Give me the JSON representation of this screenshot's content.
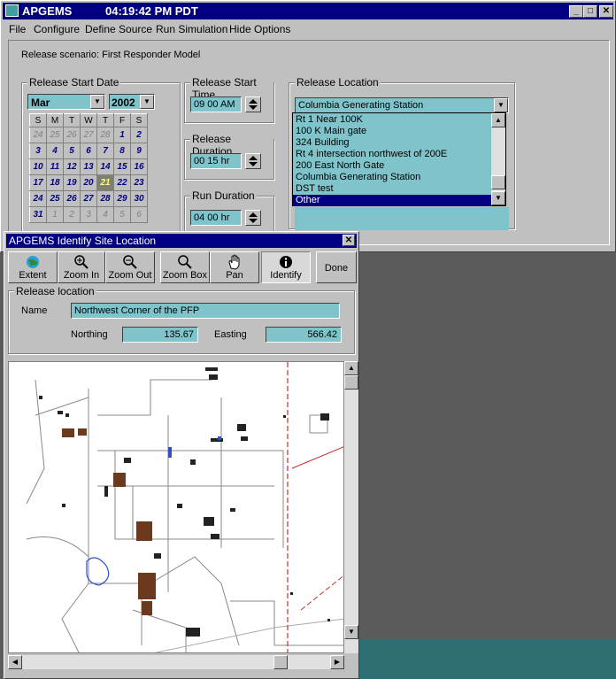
{
  "app": {
    "title": "APGEMS",
    "clock": "04:19:42 PM PDT"
  },
  "menu": [
    "File",
    "Configure",
    "Define Source",
    "Run Simulation",
    "Hide Options"
  ],
  "scenario": "Release scenario: First Responder Model",
  "start_date": {
    "label": "Release Start Date",
    "month": "Mar",
    "year": "2002",
    "weekdays": [
      "S",
      "M",
      "T",
      "W",
      "T",
      "F",
      "S"
    ],
    "weeks": [
      [
        "24",
        "25",
        "26",
        "27",
        "28",
        "1",
        "2"
      ],
      [
        "3",
        "4",
        "5",
        "6",
        "7",
        "8",
        "9"
      ],
      [
        "10",
        "11",
        "12",
        "13",
        "14",
        "15",
        "16"
      ],
      [
        "17",
        "18",
        "19",
        "20",
        "21",
        "22",
        "23"
      ],
      [
        "24",
        "25",
        "26",
        "27",
        "28",
        "29",
        "30"
      ],
      [
        "31",
        "1",
        "2",
        "3",
        "4",
        "5",
        "6"
      ]
    ],
    "selected_day": "21"
  },
  "start_time": {
    "label": "Release Start Time",
    "value": "09  00 AM"
  },
  "duration": {
    "label": "Release Duration",
    "value": "00  15 hr"
  },
  "run_duration": {
    "label": "Run Duration",
    "value": "04  00 hr"
  },
  "location": {
    "label": "Release Location",
    "selected": "Columbia Generating Station",
    "options": [
      "Rt 1 Near 100K",
      "100 K Main gate",
      "324 Building",
      "Rt 4 intersection northwest of 200E",
      "200 East North Gate",
      "Columbia Generating Station",
      "DST test",
      "Other"
    ],
    "highlighted": "Other"
  },
  "identify_window": {
    "title": "APGEMS Identify Site Location",
    "toolbar": [
      {
        "label": "Extent",
        "icon": "globe-icon"
      },
      {
        "label": "Zoom In",
        "icon": "zoom-in-icon"
      },
      {
        "label": "Zoom Out",
        "icon": "zoom-out-icon"
      },
      {
        "label": "Zoom Box",
        "icon": "zoom-box-icon"
      },
      {
        "label": "Pan",
        "icon": "hand-icon"
      },
      {
        "label": "Identify",
        "icon": "info-icon"
      }
    ],
    "done_label": "Done",
    "group_label": "Release location",
    "name_label": "Name",
    "name_value": "Northwest Corner of the PFP",
    "northing_label": "Northing",
    "northing_value": "135.67",
    "easting_label": "Easting",
    "easting_value": "566.42"
  },
  "colors": {
    "titlebar": "#000080",
    "field": "#7fc3cb",
    "face": "#c0c0c0",
    "desktop_teal": "#2f6f74"
  }
}
